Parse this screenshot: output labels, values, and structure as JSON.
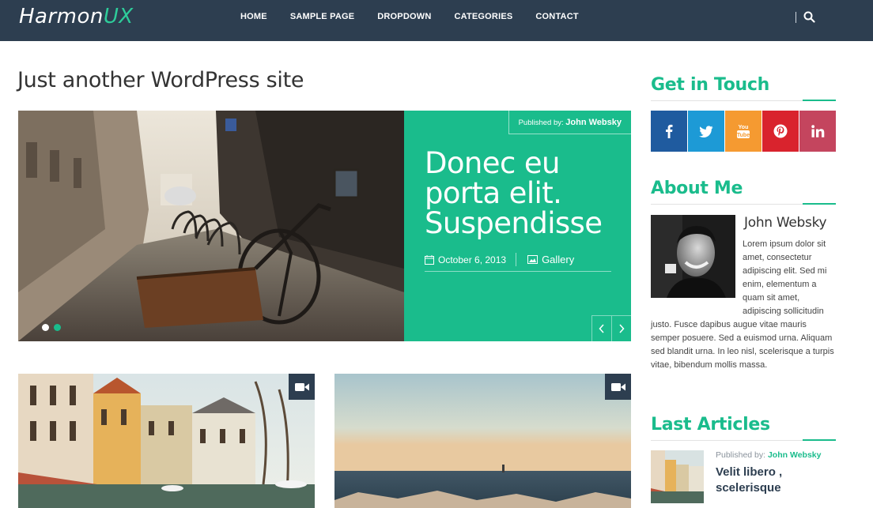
{
  "header": {
    "logo_main": "Harmon",
    "logo_accent": "UX",
    "nav": [
      "HOME",
      "SAMPLE PAGE",
      "DROPDOWN",
      "CATEGORIES",
      "CONTACT"
    ]
  },
  "main": {
    "site_description": "Just another WordPress site",
    "slider": {
      "published_label": "Published by:",
      "author": "John Websky",
      "title": "Donec eu porta elit. Suspendisse",
      "date": "October 6, 2013",
      "category": "Gallery",
      "active_slide": 2,
      "slide_count": 2
    }
  },
  "sidebar": {
    "get_in_touch": {
      "title": "Get in Touch",
      "networks": [
        {
          "icon": "facebook-icon",
          "glyph": "f",
          "color": "#1f5b9f"
        },
        {
          "icon": "twitter-icon",
          "glyph": "t",
          "color": "#1d9ad6"
        },
        {
          "icon": "youtube-icon",
          "glyph": "You Tube",
          "color": "#f59a31"
        },
        {
          "icon": "pinterest-icon",
          "glyph": "p",
          "color": "#d9232d"
        },
        {
          "icon": "linkedin-icon",
          "glyph": "in",
          "color": "#c4455e"
        }
      ]
    },
    "about": {
      "title": "About Me",
      "name": "John Websky",
      "text": "Lorem ipsum dolor sit amet, consectetur adipiscing elit. Sed mi enim, elementum a quam sit amet, adipiscing sollicitudin justo. Fusce dapibus augue vitae mauris semper posuere. Sed a euismod urna. Aliquam sed blandit urna. In leo nisl, scelerisque a turpis vitae, bibendum mollis massa."
    },
    "last_articles": {
      "title": "Last Articles",
      "items": [
        {
          "published_label": "Published by:",
          "author": "John Websky",
          "title": "Velit libero , scelerisque"
        }
      ]
    }
  },
  "colors": {
    "header_bg": "#2d3e50",
    "accent": "#1abc8c"
  }
}
